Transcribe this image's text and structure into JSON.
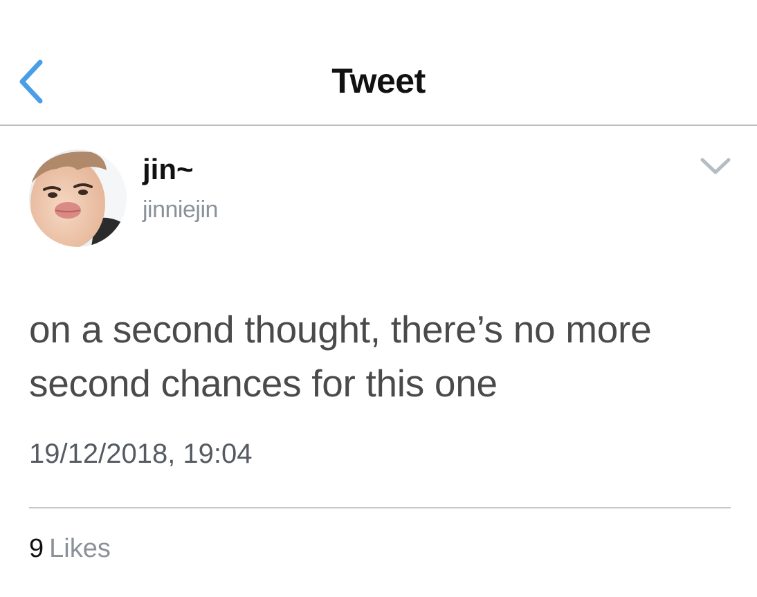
{
  "header": {
    "title": "Tweet",
    "back_icon": "chevron-left-icon",
    "accent_color": "#4a9ee8"
  },
  "tweet": {
    "author": {
      "display_name": "jin~",
      "handle": "jinniejin",
      "avatar": "avatar-photo"
    },
    "menu_icon": "chevron-down-icon",
    "text": "on a second thought, there’s no more second chances for this one",
    "timestamp": "19/12/2018, 19:04",
    "likes": {
      "count": "9",
      "label": "Likes"
    }
  }
}
